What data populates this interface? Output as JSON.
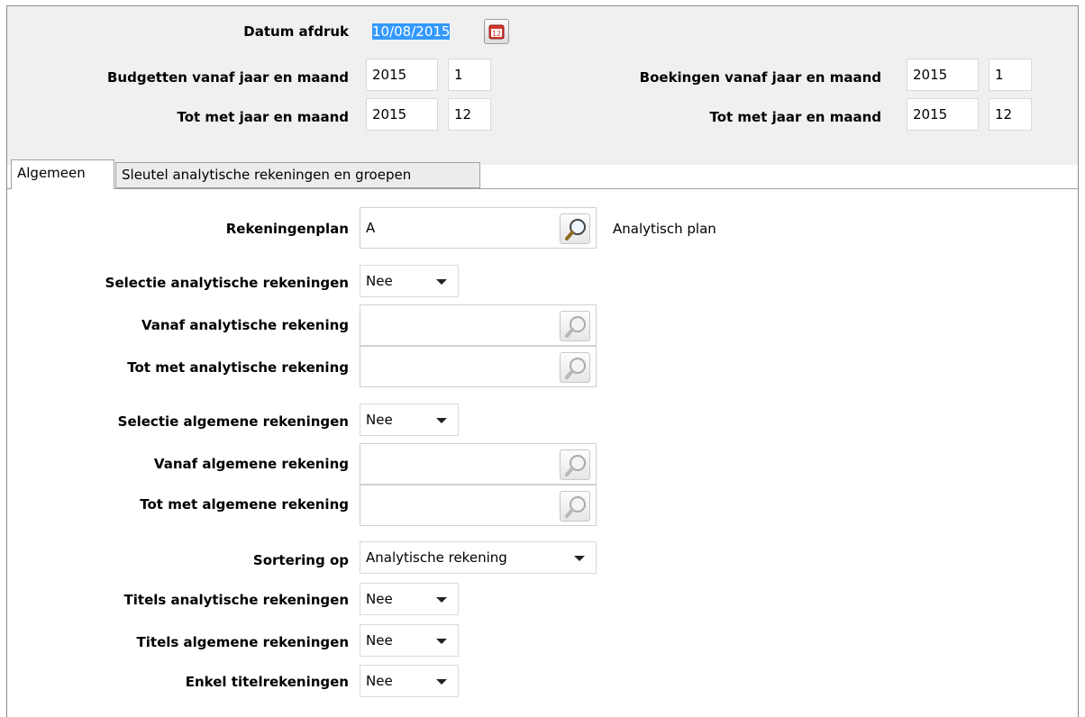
{
  "header": {
    "print_date_label": "Datum afdruk",
    "print_date_value": "10/08/2015",
    "budgets_from_label": "Budgetten vanaf jaar en maand",
    "budgets_from_year": "2015",
    "budgets_from_month": "1",
    "budgets_to_label": "Tot met jaar en maand",
    "budgets_to_year": "2015",
    "budgets_to_month": "12",
    "bookings_from_label": "Boekingen vanaf jaar en maand",
    "bookings_from_year": "2015",
    "bookings_from_month": "1",
    "bookings_to_label": "Tot met jaar en maand",
    "bookings_to_year": "2015",
    "bookings_to_month": "12",
    "calendar_icon_text": "12"
  },
  "tabs": [
    {
      "label": "Algemeen",
      "active": true
    },
    {
      "label": "Sleutel analytische rekeningen en groepen",
      "active": false
    }
  ],
  "form": {
    "chart_of_accounts_label": "Rekeningenplan",
    "chart_of_accounts_value": "A",
    "chart_of_accounts_desc": "Analytisch plan",
    "sel_analytic_label": "Selectie analytische rekeningen",
    "sel_analytic_value": "Nee",
    "from_analytic_label": "Vanaf analytische rekening",
    "from_analytic_value": "",
    "to_analytic_label": "Tot met analytische rekening",
    "to_analytic_value": "",
    "sel_general_label": "Selectie algemene rekeningen",
    "sel_general_value": "Nee",
    "from_general_label": "Vanaf algemene rekening",
    "from_general_value": "",
    "to_general_label": "Tot met algemene rekening",
    "to_general_value": "",
    "sort_label": "Sortering op",
    "sort_value": "Analytische rekening",
    "titles_analytic_label": "Titels analytische rekeningen",
    "titles_analytic_value": "Nee",
    "titles_general_label": "Titels algemene rekeningen",
    "titles_general_value": "Nee",
    "only_titles_label": "Enkel titelrekeningen",
    "only_titles_value": "Nee"
  },
  "colors": {
    "panel_bg": "#f0f0f0",
    "selection": "#3399ff",
    "calendar_red": "#d9352b"
  }
}
